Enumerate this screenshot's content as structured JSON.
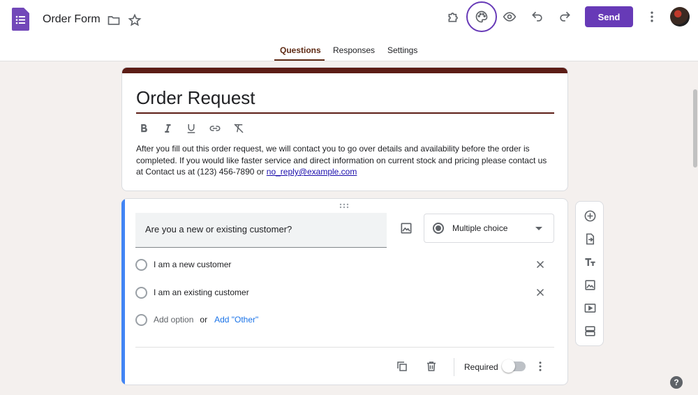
{
  "app": {
    "doc_title": "Order Form"
  },
  "toolbar": {
    "send_label": "Send"
  },
  "tabs": [
    {
      "label": "Questions"
    },
    {
      "label": "Responses"
    },
    {
      "label": "Settings"
    }
  ],
  "header": {
    "form_title": "Order Request",
    "description_text": "After you fill out this order request, we will contact you to go over details and availability before the order is completed. If you would like faster service and direct information on current stock and pricing please contact us at Contact us at (123) 456-7890 or ",
    "description_email": "no_reply@example.com"
  },
  "question": {
    "title": "Are you a new or existing customer?",
    "type": "Multiple choice",
    "options": [
      {
        "label": "I am a new customer"
      },
      {
        "label": "I am an existing customer"
      }
    ],
    "add_option": "Add option",
    "or_text": "or",
    "add_other": "Add \"Other\"",
    "required_label": "Required",
    "required": false
  },
  "colors": {
    "accent": "#673ab7",
    "theme": "#5c1d16",
    "active_question": "#4285f4"
  },
  "help": {
    "label": "?"
  }
}
